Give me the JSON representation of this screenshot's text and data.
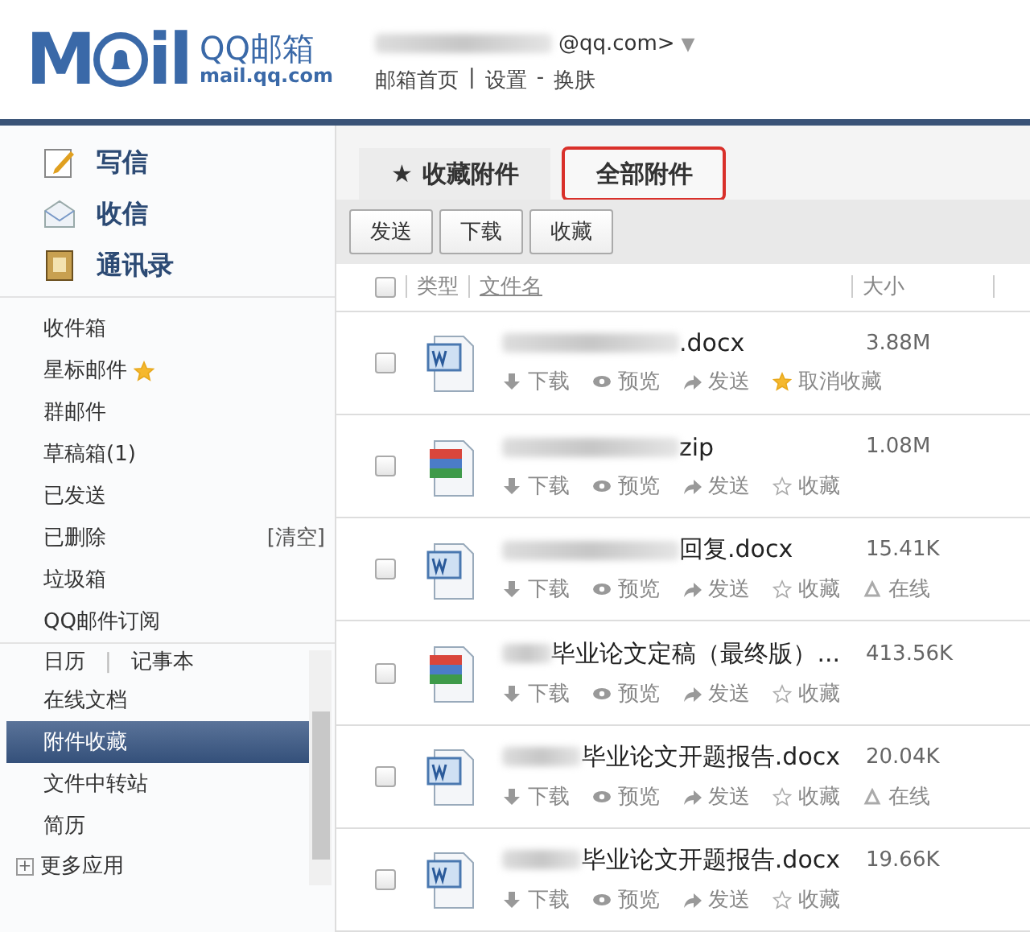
{
  "header": {
    "logo": {
      "left": "M",
      "right": "il",
      "name": "QQ邮箱",
      "domain": "mail.qq.com"
    },
    "account": "@qq.com>",
    "account_caret": "▼",
    "links": [
      {
        "label": "邮箱首页"
      },
      {
        "label": "设置"
      },
      {
        "label": "换肤"
      }
    ],
    "link_separators": [
      "|",
      "-"
    ]
  },
  "sidebar": {
    "actions": [
      {
        "label": "写信",
        "kind": "compose"
      },
      {
        "label": "收信",
        "kind": "inbox"
      },
      {
        "label": "通讯录",
        "kind": "contacts"
      }
    ],
    "folders": [
      {
        "label": "收件箱",
        "starred": false
      },
      {
        "label": "星标邮件",
        "starred": true
      },
      {
        "label": "群邮件",
        "starred": false
      },
      {
        "label": "草稿箱(1)",
        "starred": false
      },
      {
        "label": "已发送",
        "starred": false
      },
      {
        "label": "已删除",
        "starred": false,
        "action": "[清空]"
      },
      {
        "label": "垃圾箱",
        "starred": false
      },
      {
        "label": "QQ邮件订阅",
        "starred": false
      }
    ],
    "apps_row": {
      "left": "日历",
      "separator": "|",
      "right": "记事本"
    },
    "apps": [
      {
        "label": "在线文档",
        "selected": false
      },
      {
        "label": "附件收藏",
        "selected": true
      },
      {
        "label": "文件中转站",
        "selected": false
      },
      {
        "label": "简历",
        "selected": false
      }
    ],
    "more": {
      "label": "更多应用",
      "expand_glyph": "+"
    }
  },
  "tabs": [
    {
      "label": "收藏附件",
      "star": "★",
      "selected": false,
      "highlighted": false
    },
    {
      "label": "全部附件",
      "selected": true,
      "highlighted": true
    }
  ],
  "toolbar": [
    "发送",
    "下载",
    "收藏"
  ],
  "table": {
    "all_checked": false,
    "columns": [
      "类型",
      "文件名",
      "大小"
    ],
    "rows": [
      {
        "kind": "word",
        "checked": false,
        "name": ".docx",
        "size": "3.88M",
        "actions": [
          "下载",
          "预览",
          "发送"
        ],
        "favorited": true,
        "favorite_label": "取消收藏",
        "extra": ""
      },
      {
        "kind": "archive",
        "checked": false,
        "name": "zip",
        "size": "1.08M",
        "actions": [
          "下载",
          "预览",
          "发送"
        ],
        "favorited": false,
        "favorite_label": "收藏",
        "extra": ""
      },
      {
        "kind": "word",
        "checked": false,
        "name": "回复.docx",
        "size": "15.41K",
        "actions": [
          "下载",
          "预览",
          "发送"
        ],
        "favorited": false,
        "favorite_label": "收藏",
        "extra": "在线"
      },
      {
        "kind": "archive",
        "checked": false,
        "name": "毕业论文定稿（最终版）...",
        "size": "413.56K",
        "actions": [
          "下载",
          "预览",
          "发送"
        ],
        "favorited": false,
        "favorite_label": "收藏",
        "extra": ""
      },
      {
        "kind": "word",
        "checked": false,
        "name": "毕业论文开题报告.docx",
        "size": "20.04K",
        "actions": [
          "下载",
          "预览",
          "发送"
        ],
        "favorited": false,
        "favorite_label": "收藏",
        "extra": "在线"
      },
      {
        "kind": "word",
        "checked": false,
        "name": "毕业论文开题报告.docx",
        "size": "19.66K",
        "actions": [
          "下载",
          "预览",
          "发送"
        ],
        "favorited": false,
        "favorite_label": "收藏",
        "extra": ""
      }
    ]
  }
}
